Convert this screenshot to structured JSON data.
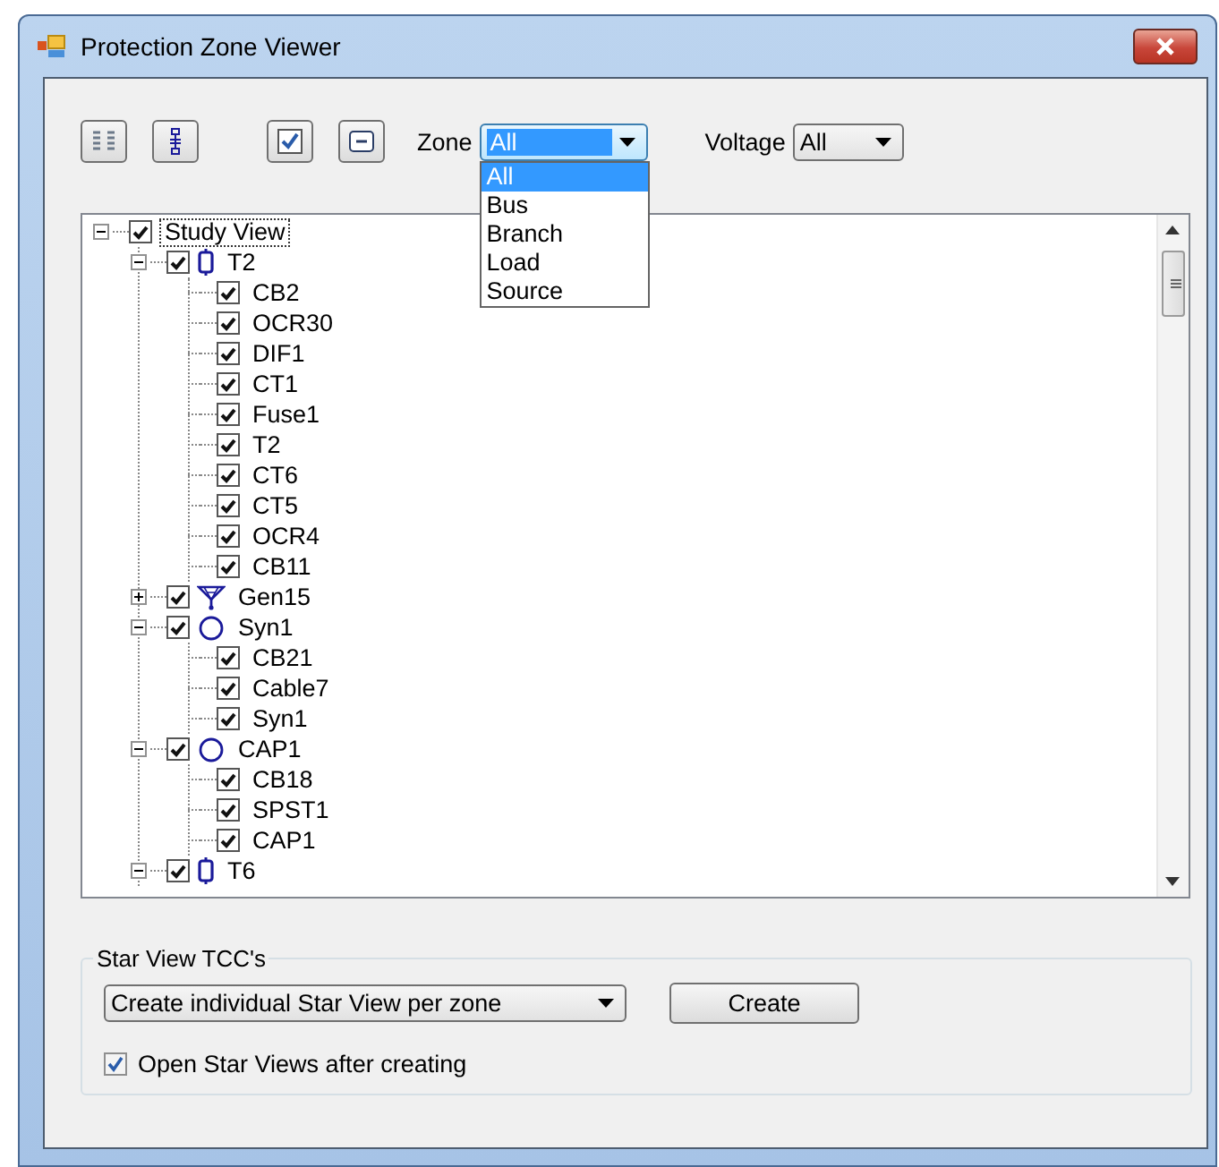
{
  "window": {
    "title": "Protection Zone Viewer"
  },
  "toolbar": {
    "zone": {
      "label": "Zone",
      "value": "All",
      "open": true,
      "options": [
        {
          "label": "All",
          "selected": true
        },
        {
          "label": "Bus",
          "selected": false
        },
        {
          "label": "Branch",
          "selected": false
        },
        {
          "label": "Load",
          "selected": false
        },
        {
          "label": "Source",
          "selected": false
        }
      ]
    },
    "voltage": {
      "label": "Voltage",
      "value": "All"
    }
  },
  "tree": [
    {
      "label": "Study View",
      "checked": true,
      "expanded": true,
      "selected": true,
      "children": [
        {
          "label": "T2",
          "kind": "transformer",
          "checked": true,
          "expanded": true,
          "selected": false,
          "children": [
            {
              "label": "CB2",
              "checked": true,
              "selected": false
            },
            {
              "label": "OCR30",
              "checked": true,
              "selected": false
            },
            {
              "label": "DIF1",
              "checked": true,
              "selected": false
            },
            {
              "label": "CT1",
              "checked": true,
              "selected": false
            },
            {
              "label": "Fuse1",
              "checked": true,
              "selected": false
            },
            {
              "label": "T2",
              "checked": true,
              "selected": false
            },
            {
              "label": "CT6",
              "checked": true,
              "selected": false
            },
            {
              "label": "CT5",
              "checked": true,
              "selected": false
            },
            {
              "label": "OCR4",
              "checked": true,
              "selected": false
            },
            {
              "label": "CB11",
              "checked": true,
              "selected": false
            }
          ]
        },
        {
          "label": "Gen15",
          "kind": "generator",
          "checked": true,
          "expanded": false,
          "selected": false
        },
        {
          "label": "Syn1",
          "kind": "circle",
          "checked": true,
          "expanded": true,
          "selected": false,
          "children": [
            {
              "label": "CB21",
              "checked": true,
              "selected": false
            },
            {
              "label": "Cable7",
              "checked": true,
              "selected": false
            },
            {
              "label": "Syn1",
              "checked": true,
              "selected": false
            }
          ]
        },
        {
          "label": "CAP1",
          "kind": "circle",
          "checked": true,
          "expanded": true,
          "selected": false,
          "children": [
            {
              "label": "CB18",
              "checked": true,
              "selected": false
            },
            {
              "label": "SPST1",
              "checked": true,
              "selected": false
            },
            {
              "label": "CAP1",
              "checked": true,
              "selected": false
            }
          ]
        },
        {
          "label": "T6",
          "kind": "transformer",
          "checked": true,
          "expanded": true,
          "selected": false
        }
      ]
    }
  ],
  "star_view": {
    "title": "Star View TCC's",
    "mode": "Create individual Star View per zone",
    "button": "Create",
    "open_after": {
      "label": "Open Star Views after creating",
      "checked": true
    }
  }
}
